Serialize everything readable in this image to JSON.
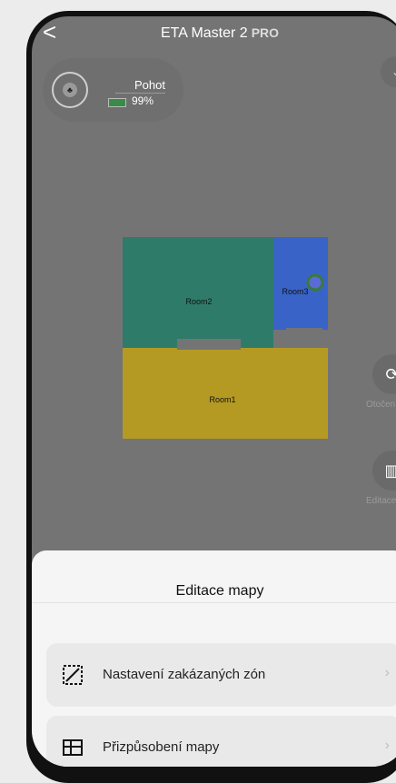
{
  "header": {
    "back": "<",
    "title": "ETA Master 2",
    "badge": "PRO"
  },
  "status": {
    "mode": "Pohot",
    "battery": "99%"
  },
  "map": {
    "rooms": [
      {
        "name": "Room2",
        "color": "#2f7b6a"
      },
      {
        "name": "Room3",
        "color": "#3a63c8"
      },
      {
        "name": "Room1",
        "color": "#b49a23"
      }
    ]
  },
  "side_buttons": [
    {
      "label": "Otočení mapy",
      "icon": "rotate-icon"
    },
    {
      "label": "Editace mapy",
      "icon": "map-icon"
    }
  ],
  "sheet": {
    "title": "Editace mapy",
    "items": [
      {
        "label": "Nastavení zakázaných zón",
        "icon": "restricted-zone-icon"
      },
      {
        "label": "Přizpůsobení mapy",
        "icon": "map-customize-icon"
      }
    ]
  }
}
